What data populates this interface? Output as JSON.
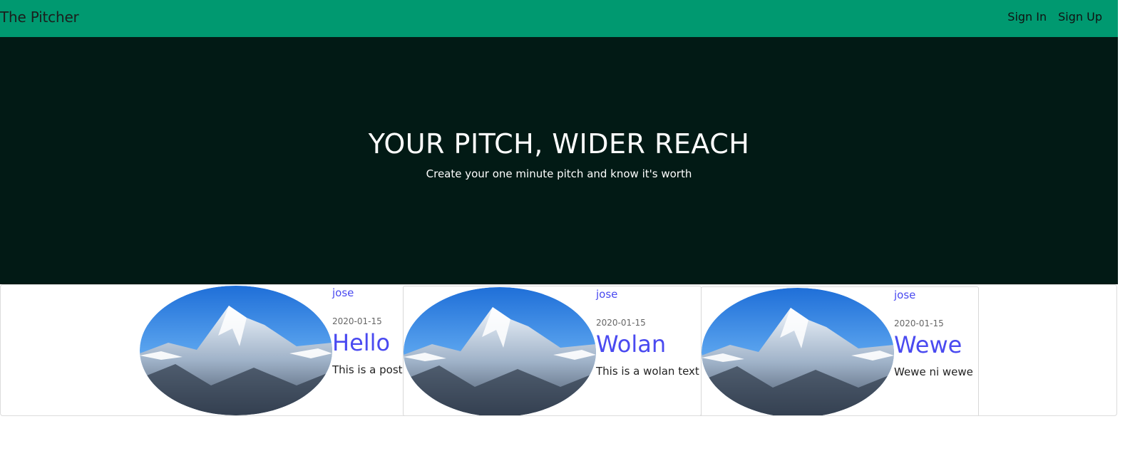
{
  "navbar": {
    "brand": "The Pitcher",
    "links": [
      "Sign In",
      "Sign Up"
    ],
    "background": "#009970"
  },
  "hero": {
    "title": "YOUR PITCH, WIDER REACH",
    "subtitle": "Create your one minute pitch and know it's worth",
    "background": "#021a15"
  },
  "pitches": [
    {
      "author": "jose",
      "date": "2020-01-15",
      "title": "Hello",
      "text": "This is a post",
      "image_icon": "mountain-image"
    },
    {
      "author": "jose",
      "date": "2020-01-15",
      "title": "Wolan",
      "text": "This is a wolan text",
      "image_icon": "mountain-image"
    },
    {
      "author": "jose",
      "date": "2020-01-15",
      "title": "Wewe",
      "text": "Wewe ni wewe",
      "image_icon": "mountain-image"
    }
  ],
  "colors": {
    "link": "#4a4af0"
  }
}
